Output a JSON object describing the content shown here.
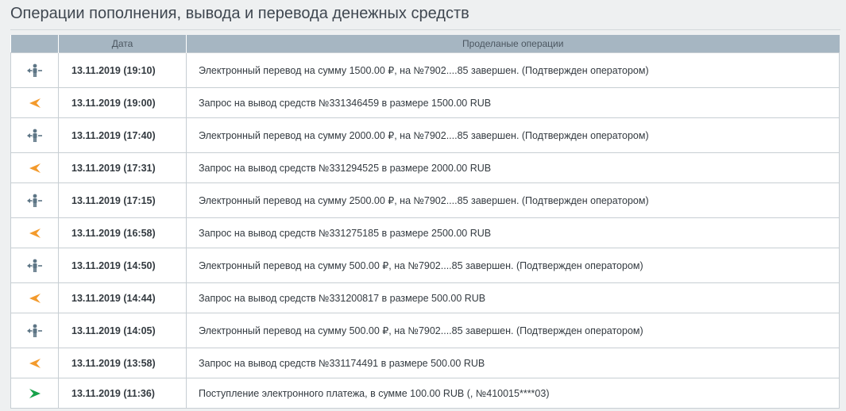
{
  "page_title": "Операции пополнения, вывода и перевода денежных средств",
  "table": {
    "headers": {
      "icon": "",
      "date": "Дата",
      "operations": "Проделаные операции"
    },
    "rows": [
      {
        "icon": "transfer-person-icon",
        "date": "13.11.2019 (19:10)",
        "text": "Электронный перевод на сумму 1500.00 ₽, на №7902....85 завершен. (Подтвержден оператором)"
      },
      {
        "icon": "withdraw-arrow-icon",
        "date": "13.11.2019 (19:00)",
        "text": "Запрос на вывод средств №331346459 в размере 1500.00 RUB"
      },
      {
        "icon": "transfer-person-icon",
        "date": "13.11.2019 (17:40)",
        "text": "Электронный перевод на сумму 2000.00 ₽, на №7902....85 завершен. (Подтвержден оператором)"
      },
      {
        "icon": "withdraw-arrow-icon",
        "date": "13.11.2019 (17:31)",
        "text": "Запрос на вывод средств №331294525 в размере 2000.00 RUB"
      },
      {
        "icon": "transfer-person-icon",
        "date": "13.11.2019 (17:15)",
        "text": "Электронный перевод на сумму 2500.00 ₽, на №7902....85 завершен. (Подтвержден оператором)"
      },
      {
        "icon": "withdraw-arrow-icon",
        "date": "13.11.2019 (16:58)",
        "text": "Запрос на вывод средств №331275185 в размере 2500.00 RUB"
      },
      {
        "icon": "transfer-person-icon",
        "date": "13.11.2019 (14:50)",
        "text": "Электронный перевод на сумму 500.00 ₽, на №7902....85 завершен. (Подтвержден оператором)"
      },
      {
        "icon": "withdraw-arrow-icon",
        "date": "13.11.2019 (14:44)",
        "text": "Запрос на вывод средств №331200817 в размере 500.00 RUB"
      },
      {
        "icon": "transfer-person-icon",
        "date": "13.11.2019 (14:05)",
        "text": "Электронный перевод на сумму 500.00 ₽, на №7902....85 завершен. (Подтвержден оператором)"
      },
      {
        "icon": "withdraw-arrow-icon",
        "date": "13.11.2019 (13:58)",
        "text": "Запрос на вывод средств №331174491 в размере 500.00 RUB"
      },
      {
        "icon": "deposit-arrow-icon",
        "date": "13.11.2019 (11:36)",
        "text": "Поступление электронного платежа, в сумме 100.00 RUB (, №410015****03)"
      }
    ]
  },
  "colors": {
    "header_bg": "#a6b6c2",
    "transfer_icon": "#5e7686",
    "withdraw_icon": "#f39a2c",
    "deposit_icon": "#17a24a"
  }
}
